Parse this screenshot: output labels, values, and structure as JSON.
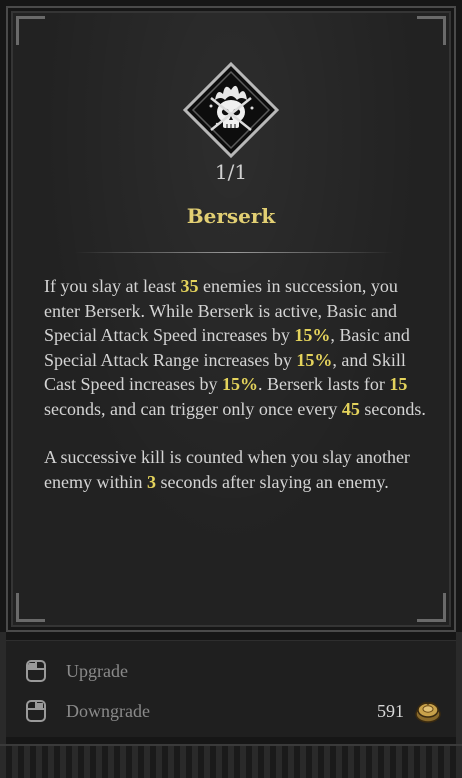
{
  "skill": {
    "level": "1/1",
    "name": "Berserk",
    "icon": "skull-flame-icon"
  },
  "description": {
    "paragraph1": [
      {
        "t": "If you slay at least "
      },
      {
        "t": "35",
        "hl": true
      },
      {
        "t": " enemies in succession, you enter Berserk. While Berserk is active, Basic and Special Attack Speed increases by "
      },
      {
        "t": "15%",
        "hl": true
      },
      {
        "t": ", Basic and Special Attack Range increases by "
      },
      {
        "t": "15%",
        "hl": true
      },
      {
        "t": ", and Skill Cast Speed increases by "
      },
      {
        "t": "15%",
        "hl": true
      },
      {
        "t": ". Berserk lasts for "
      },
      {
        "t": "15",
        "hl": true
      },
      {
        "t": " seconds, and can trigger only once every "
      },
      {
        "t": "45",
        "hl": true
      },
      {
        "t": " seconds."
      }
    ],
    "paragraph2": [
      {
        "t": "A successive kill is counted when you slay another enemy within "
      },
      {
        "t": "3",
        "hl": true
      },
      {
        "t": " seconds after slaying an enemy."
      }
    ]
  },
  "actions": {
    "upgrade_label": "Upgrade",
    "downgrade_label": "Downgrade",
    "upgrade_icon": "mouse-left-click-icon",
    "downgrade_icon": "mouse-right-click-icon"
  },
  "cost": {
    "value": "591",
    "icon": "gold-coin-pouch-icon"
  },
  "colors": {
    "highlight": "#e4d35c",
    "title": "#e2cf73",
    "text": "#d4d4d4",
    "muted": "#8a8a8a"
  }
}
